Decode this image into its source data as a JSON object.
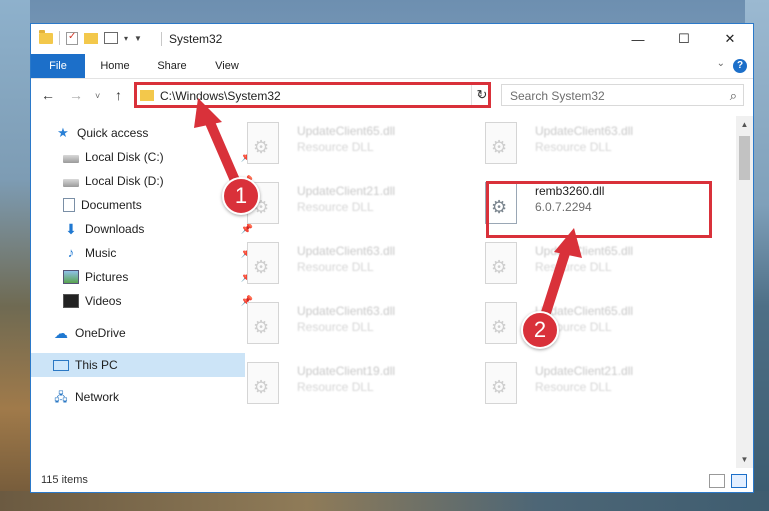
{
  "window": {
    "title": "System32"
  },
  "caption": {
    "minimize": "—",
    "maximize": "☐",
    "close": "✕"
  },
  "ribbon": {
    "tabs": [
      {
        "label": "File"
      },
      {
        "label": "Home"
      },
      {
        "label": "Share"
      },
      {
        "label": "View"
      }
    ],
    "help": "?"
  },
  "navigation": {
    "back": "←",
    "forward": "→",
    "recent": "˅",
    "up": "↑",
    "address": "C:\\Windows\\System32",
    "refresh": "↻",
    "search_placeholder": "Search System32"
  },
  "sidebar": {
    "items": [
      {
        "label": "Quick access",
        "icon": "star-icon"
      },
      {
        "label": "Local Disk (C:)",
        "icon": "disk-icon",
        "pinned": true
      },
      {
        "label": "Local Disk (D:)",
        "icon": "disk-icon",
        "pinned": true
      },
      {
        "label": "Documents",
        "icon": "documents-icon",
        "pinned": true
      },
      {
        "label": "Downloads",
        "icon": "downloads-icon",
        "pinned": true
      },
      {
        "label": "Music",
        "icon": "music-icon",
        "pinned": true
      },
      {
        "label": "Pictures",
        "icon": "pictures-icon",
        "pinned": true
      },
      {
        "label": "Videos",
        "icon": "videos-icon",
        "pinned": true
      },
      {
        "label": "OneDrive",
        "icon": "cloud-icon"
      },
      {
        "label": "This PC",
        "icon": "computer-icon",
        "selected": true
      },
      {
        "label": "Network",
        "icon": "network-icon"
      }
    ]
  },
  "files": [
    {
      "name": "UpdateClient65.dll",
      "type": "Resource DLL"
    },
    {
      "name": "UpdateClient63.dll",
      "type": "Resource DLL"
    },
    {
      "name": "UpdateClient21.dll",
      "type": "Resource DLL"
    },
    {
      "name": "remb3260.dll",
      "type": "6.0.7.2294",
      "highlighted": true
    },
    {
      "name": "UpdateClient63.dll",
      "type": "Resource DLL"
    },
    {
      "name": "UpdateClient65.dll",
      "type": "Resource DLL"
    },
    {
      "name": "UpdateClient63.dll",
      "type": "Resource DLL"
    },
    {
      "name": "UpdateClient65.dll",
      "type": "Resource DLL"
    },
    {
      "name": "UpdateClient19.dll",
      "type": "Resource DLL"
    },
    {
      "name": "UpdateClient21.dll",
      "type": "Resource DLL"
    }
  ],
  "status": {
    "item_count": "115 items"
  },
  "annotations": {
    "step1": "1",
    "step2": "2",
    "color": "#d9313a"
  }
}
